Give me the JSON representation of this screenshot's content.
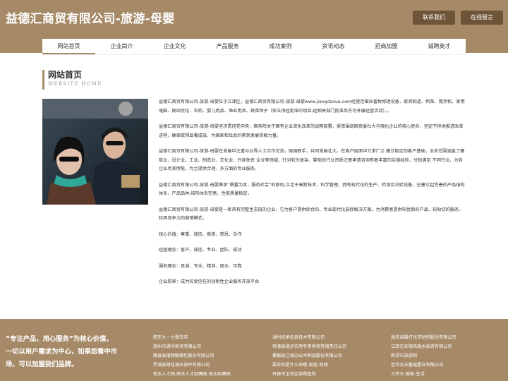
{
  "header": {
    "title": "益德汇商贸有限公司-旅游-母婴",
    "contact_label": "联系我们",
    "message_label": "在线留言"
  },
  "nav": [
    "网站首页",
    "企业简介",
    "企业文化",
    "产品服务",
    "成功案例",
    "资讯动态",
    "招商加盟",
    "诚聘英才"
  ],
  "nav_active": "网站首页",
  "section": {
    "title": "网站首页",
    "subtitle": "WEBSITE HOME"
  },
  "paragraphs": [
    "益德汇商贸有限公司-旅游-母婴位于江津区，益德汇商贸有限公司-旅游-母婴www.jiangdaxue.com经营范围含畜牧修理设备、家具制造、鸭苗、搅拌机、家用电脑、网站优化、农药、婴儿用品、渔业用具、蔬菜种子（依法须经批准的项目,经相关部门批准后方可开展经营活动）。。",
    "益德汇商贸有限公司-旅游-母婴坚决贯彻党中央、国务院关于国有企业深化改革的战略部署，紧密围绕国资委社大与强化企业的核心使命，坚定不移地推进改革进程，确保取得显著成效，为国家和社会的繁荣发展贡献力量。",
    "益德汇商贸有限公司-旅游-母婴在发展中注重与业界人士合作交流，强强联手，共同发展壮大。在客户层面中力求广泛 建立稳定的客户基础，业务范围涵盖了建筑业、设计业、工业、制造业、文化业、外商独资 企业等领域，针对较为复杂、繁琐的行业资质注册申请咨询有着丰富的实操经验，分别满足 不同行业，为各企业尽其所能，为之提供合理、多方面的专业服务。",
    "益德汇商贸有限公司-旅游-母婴秉承“质量为本，服务社会”的原则,立足于高新技术，科学管理，拥有现代化的生产、检测及试验设备，已建立起完善的产品结构体系，产品品种,结构体系完善，性能质量稳定。",
    "益德汇商贸有限公司-旅游-母婴是一家具有完整生态链的企业，它为客户提供综合的、专业现代化装修解决方案。为消费者提供较优质的产品、较贴切的服务、较具竞争力的营销模式。",
    "核心价值：尊重、诚信、推崇、感恩、合作",
    "经营理念：客户、诚信、专业、团队、成功",
    "服务理念：真诚、专业、精准、周全、可靠",
    "企业愿景：成为较受信任的创新性企业服务开放平台"
  ],
  "footer": {
    "slogan": "“专注产品，用心服务”为核心价值，一切以用户需求为中心，如果您看中市场，可以加盟我们品牌。",
    "col1": [
      "肥东九一七餐饮店",
      "滁州市满华商贸有限公司",
      "鹿县县植物额面包股份有限公司",
      "罗源县呀在液压部件有限公司",
      "徐水人才网-徐水人才招聘网-徐水招聘网"
    ],
    "col2": [
      "湖州间承信息技术有限公司",
      "梓潼县缘运农用专用物资有限责任公司",
      "桑都县辽祿办公木制品股份有限公司",
      "属羊的是什么命啊-家居-商闻",
      "开原市卫协会协和医院"
    ],
    "col3": [
      "高邑县霞打化学助剂股份有限公司",
      "江西吉安顺风稳水旅游有限公司",
      "新郑市旅游网",
      "金华太古嘉瑞置业有限公司",
      "三芹王-搜索-生活"
    ]
  }
}
